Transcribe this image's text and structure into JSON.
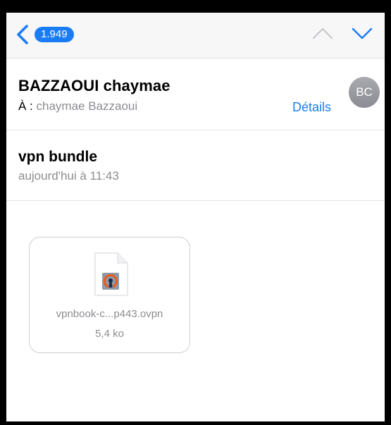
{
  "navbar": {
    "badge_count": "1.949",
    "accent_color": "#1a7cf5"
  },
  "header": {
    "sender": "BAZZAOUI chaymae",
    "to_prefix": "À : ",
    "recipient": "chaymae Bazzaoui",
    "details_label": "Détails",
    "avatar_initials": "BC"
  },
  "message": {
    "subject": "vpn bundle",
    "date": "aujourd'hui à 11:43"
  },
  "attachment": {
    "icon": "openvpn-file-icon",
    "filename": "vpnbook-c...p443.ovpn",
    "size": "5,4 ko"
  }
}
